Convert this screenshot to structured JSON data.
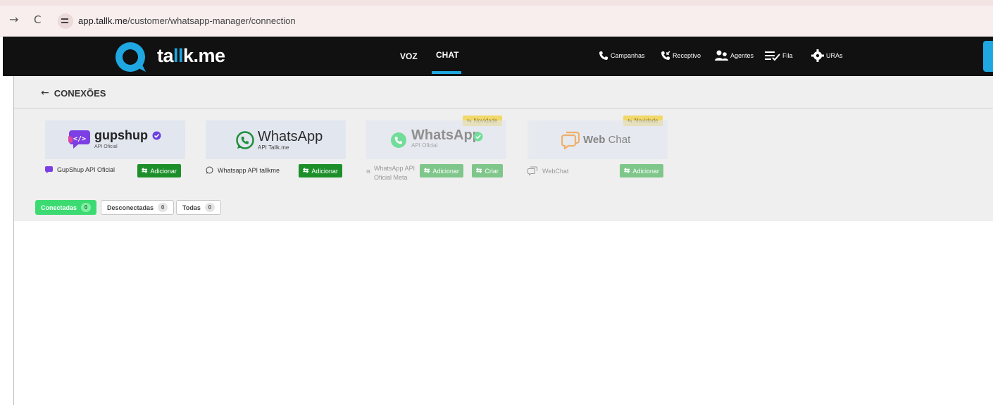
{
  "browser": {
    "url_host": "app.tallk.me",
    "url_path": "/customer/whatsapp-manager/connection"
  },
  "header": {
    "logo_prefix": "ta",
    "logo_ll": "ll",
    "logo_suffix": "k.me",
    "tabs": [
      {
        "label": "VOZ",
        "active": false
      },
      {
        "label": "CHAT",
        "active": true
      }
    ],
    "links": [
      {
        "label": "Campanhas",
        "icon": "phone-icon"
      },
      {
        "label": "Receptivo",
        "icon": "incoming-call-icon"
      },
      {
        "label": "Agentes",
        "icon": "agents-icon"
      },
      {
        "label": "Fila",
        "icon": "queue-icon"
      },
      {
        "label": "URAs",
        "icon": "gear-icon"
      }
    ]
  },
  "page": {
    "title": "CONEXÕES"
  },
  "cards": [
    {
      "brand": "gupshup",
      "sub": "API Oficial",
      "label": "GupShup API Oficial",
      "buttons": [
        "Adicionar"
      ],
      "badge": ""
    },
    {
      "brand": "WhatsApp",
      "sub": "API Tallk.me",
      "label": "Whatsapp API tallkme",
      "buttons": [
        "Adicionar"
      ],
      "badge": ""
    },
    {
      "brand": "WhatsApp",
      "sub": "API Oficial",
      "label_line1": "WhatsApp API",
      "label_line2": "Oficial Meta",
      "buttons": [
        "Adicionar",
        "Criar"
      ],
      "badge": "Novidade"
    },
    {
      "brand_bold": "Web",
      "brand_rest": "Chat",
      "label": "WebChat",
      "buttons": [
        "Adicionar"
      ],
      "badge": "Novidade"
    }
  ],
  "filters": [
    {
      "label": "Conectadas",
      "count": "0",
      "active": true
    },
    {
      "label": "Desconectadas",
      "count": "0",
      "active": false
    },
    {
      "label": "Todas",
      "count": "0",
      "active": false
    }
  ],
  "colors": {
    "accent": "#1ea7e1",
    "add_button": "#1d8f2a",
    "active_filter": "#3cdb72",
    "header_bg": "#111111",
    "badge": "#f1d86a"
  }
}
